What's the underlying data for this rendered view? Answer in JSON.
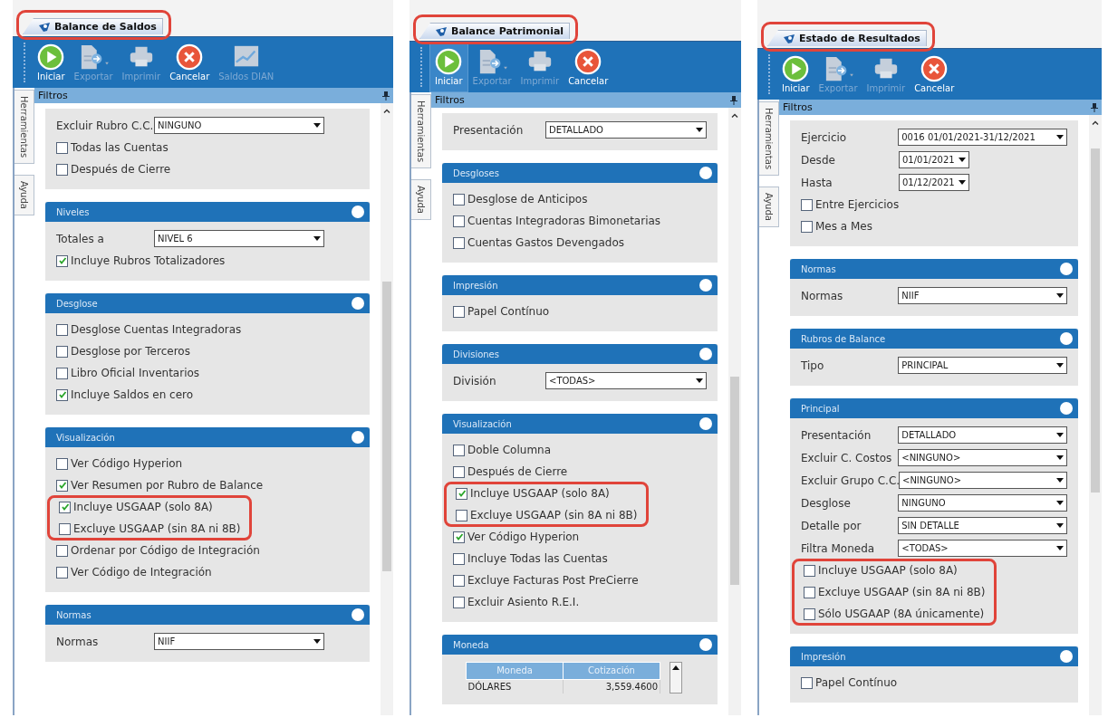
{
  "panels": [
    {
      "tab": {
        "title": "Balance de Saldos",
        "highlighted": true
      },
      "toolbar": [
        {
          "kind": "play",
          "label": "Iniciar",
          "disabled": false,
          "highlighted": false
        },
        {
          "kind": "export",
          "label": "Exportar",
          "disabled": true,
          "highlighted": false
        },
        {
          "kind": "print",
          "label": "Imprimir",
          "disabled": true,
          "highlighted": false
        },
        {
          "kind": "cancel",
          "label": "Cancelar",
          "disabled": false,
          "highlighted": false
        },
        {
          "kind": "chart",
          "label": "Saldos DIAN",
          "disabled": true,
          "highlighted": false
        }
      ],
      "side_tabs": [
        "Herramientas",
        "Ayuda"
      ],
      "filter_header": "Filtros",
      "sections": [
        {
          "rows": [
            {
              "kind": "field",
              "label": "Excluir Rubro C.C.",
              "value": "NINGUNO"
            },
            {
              "kind": "check",
              "label": "Todas las Cuentas",
              "checked": false
            },
            {
              "kind": "check",
              "label": "Después de Cierre",
              "checked": false
            }
          ]
        },
        {
          "title": "Niveles",
          "rows": [
            {
              "kind": "field",
              "label": "Totales a",
              "value": "NIVEL 6"
            },
            {
              "kind": "check",
              "label": "Incluye Rubros Totalizadores",
              "checked": true
            }
          ]
        },
        {
          "title": "Desglose",
          "rows": [
            {
              "kind": "check",
              "label": "Desglose Cuentas Integradoras",
              "checked": false
            },
            {
              "kind": "check",
              "label": "Desglose por Terceros",
              "checked": false
            },
            {
              "kind": "check",
              "label": "Libro Oficial Inventarios",
              "checked": false
            },
            {
              "kind": "check",
              "label": "Incluye Saldos en cero",
              "checked": true
            }
          ]
        },
        {
          "title": "Visualización",
          "rows": [
            {
              "kind": "check",
              "label": "Ver Código Hyperion",
              "checked": false
            },
            {
              "kind": "check",
              "label": "Ver Resumen por Rubro de Balance",
              "checked": true
            },
            {
              "kind": "group",
              "highlighted": true,
              "rows": [
                {
                  "kind": "check",
                  "label": "Incluye USGAAP (solo 8A)",
                  "checked": true
                },
                {
                  "kind": "check",
                  "label": "Excluye USGAAP (sin 8A ni 8B)",
                  "checked": false
                }
              ]
            },
            {
              "kind": "check",
              "label": "Ordenar por  Código de Integración",
              "checked": false
            },
            {
              "kind": "check",
              "label": "Ver Código de Integración",
              "checked": false
            }
          ]
        },
        {
          "title": "Normas",
          "rows": [
            {
              "kind": "field",
              "label": "Normas",
              "value": "NIIF"
            }
          ]
        }
      ]
    },
    {
      "tab": {
        "title": "Balance Patrimonial",
        "highlighted": true
      },
      "toolbar": [
        {
          "kind": "play",
          "label": "Iniciar",
          "disabled": false,
          "highlighted": true
        },
        {
          "kind": "export",
          "label": "Exportar",
          "disabled": true,
          "highlighted": false
        },
        {
          "kind": "print",
          "label": "Imprimir",
          "disabled": true,
          "highlighted": false
        },
        {
          "kind": "cancel",
          "label": "Cancelar",
          "disabled": false,
          "highlighted": false
        }
      ],
      "side_tabs": [
        "Herramientas",
        "Ayuda"
      ],
      "filter_header": "Filtros",
      "sections": [
        {
          "rows": [
            {
              "kind": "field",
              "label": "Presentación",
              "value": "DETALLADO"
            }
          ]
        },
        {
          "title": "Desgloses",
          "rows": [
            {
              "kind": "check",
              "label": "Desglose de Anticipos",
              "checked": false
            },
            {
              "kind": "check",
              "label": "Cuentas Integradoras Bimonetarias",
              "checked": false
            },
            {
              "kind": "check",
              "label": "Cuentas Gastos Devengados",
              "checked": false
            }
          ]
        },
        {
          "title": "Impresión",
          "rows": [
            {
              "kind": "check",
              "label": "Papel Contínuo",
              "checked": false
            }
          ]
        },
        {
          "title": "Divisiones",
          "rows": [
            {
              "kind": "field",
              "label": "División",
              "value": "<TODAS>"
            }
          ]
        },
        {
          "title": "Visualización",
          "rows": [
            {
              "kind": "check",
              "label": "Doble Columna",
              "checked": false
            },
            {
              "kind": "check",
              "label": "Después de Cierre",
              "checked": false
            },
            {
              "kind": "group",
              "highlighted": true,
              "rows": [
                {
                  "kind": "check",
                  "label": "Incluye USGAAP (solo 8A)",
                  "checked": true
                },
                {
                  "kind": "check",
                  "label": "Excluye USGAAP (sin 8A ni 8B)",
                  "checked": false
                }
              ]
            },
            {
              "kind": "check",
              "label": "Ver Código Hyperion",
              "checked": true
            },
            {
              "kind": "check",
              "label": "Incluye Todas las Cuentas",
              "checked": false
            },
            {
              "kind": "check",
              "label": "Excluye Facturas Post PreCierre",
              "checked": false
            },
            {
              "kind": "check",
              "label": "Excluir Asiento R.E.I.",
              "checked": false
            }
          ]
        },
        {
          "title": "Moneda",
          "rows": [
            {
              "kind": "table",
              "columns": [
                "Moneda",
                "Cotización"
              ],
              "rows": [
                [
                  "DÓLARES",
                  "3,559.4600"
                ]
              ]
            }
          ]
        }
      ]
    },
    {
      "tab": {
        "title": "Estado de Resultados",
        "highlighted": true
      },
      "toolbar": [
        {
          "kind": "play",
          "label": "Iniciar",
          "disabled": false,
          "highlighted": false
        },
        {
          "kind": "export",
          "label": "Exportar",
          "disabled": true,
          "highlighted": false
        },
        {
          "kind": "print",
          "label": "Imprimir",
          "disabled": true,
          "highlighted": false
        },
        {
          "kind": "cancel",
          "label": "Cancelar",
          "disabled": false,
          "highlighted": false
        }
      ],
      "side_tabs": [
        "Herramientas",
        "Ayuda"
      ],
      "filter_header": "Filtros",
      "sections": [
        {
          "rows": [
            {
              "kind": "field",
              "label": "Ejercicio",
              "value": "0016 01/01/2021-31/12/2021"
            },
            {
              "kind": "date",
              "label": "Desde",
              "value": "01/01/2021"
            },
            {
              "kind": "date",
              "label": "Hasta",
              "value": "01/12/2021"
            },
            {
              "kind": "check",
              "label": "Entre Ejercicios",
              "checked": false
            },
            {
              "kind": "check",
              "label": "Mes a Mes",
              "checked": false
            }
          ]
        },
        {
          "title": "Normas",
          "rows": [
            {
              "kind": "field",
              "label": "Normas",
              "value": "NIIF"
            }
          ]
        },
        {
          "title": "Rubros de Balance",
          "rows": [
            {
              "kind": "field",
              "label": "Tipo",
              "value": "PRINCIPAL"
            }
          ]
        },
        {
          "title": "Principal",
          "rows": [
            {
              "kind": "field",
              "label": "Presentación",
              "value": "DETALLADO"
            },
            {
              "kind": "field",
              "label": "Excluir C. Costos",
              "value": "<NINGUNO>"
            },
            {
              "kind": "field",
              "label": "Excluir Grupo C.C.",
              "value": "<NINGUNO>"
            },
            {
              "kind": "field",
              "label": "Desglose",
              "value": "NINGUNO"
            },
            {
              "kind": "field",
              "label": "Detalle por",
              "value": "SIN DETALLE"
            },
            {
              "kind": "field",
              "label": "Filtra Moneda",
              "value": "<TODAS>"
            },
            {
              "kind": "group",
              "highlighted": true,
              "rows": [
                {
                  "kind": "check",
                  "label": "Incluye USGAAP (solo 8A)",
                  "checked": false
                },
                {
                  "kind": "check",
                  "label": "Excluye USGAAP (sin 8A ni 8B)",
                  "checked": false
                },
                {
                  "kind": "check",
                  "label": "Sólo USGAAP (8A únicamente)",
                  "checked": false
                }
              ]
            }
          ]
        },
        {
          "title": "Impresión",
          "rows": [
            {
              "kind": "check",
              "label": "Papel Contínuo",
              "checked": false
            }
          ]
        }
      ]
    }
  ]
}
